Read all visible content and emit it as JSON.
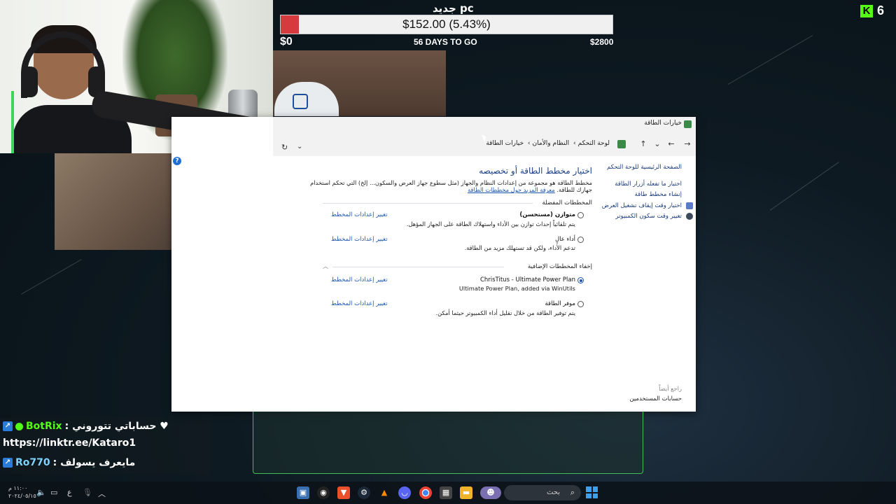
{
  "goal": {
    "title": "جديد pc",
    "amount_text": "$152.00 (5.43%)",
    "progress_fraction": 0.0543,
    "min_label": "$0",
    "days_label": "56 DAYS TO GO",
    "max_label": "$2800",
    "fill_color": "#d63a3f"
  },
  "kick": {
    "logo_letter": "K",
    "viewer_count": "6",
    "brand_color": "#53fc18"
  },
  "window": {
    "title": "خيارات الطاقة",
    "address": {
      "crumbs": [
        "لوحة التحكم",
        "النظام والأمان",
        "خيارات الطاقة"
      ]
    },
    "sidebar": {
      "home": "الصفحة الرئيسية للوحة التحكم",
      "items": [
        "اختيار ما تفعله أزرار الطاقة",
        "إنشاء مخطط طاقة",
        "اختيار وقت إيقاف تشغيل العرض",
        "تغيير وقت سكون الكمبيوتر"
      ],
      "see_also": "راجع أيضاً",
      "user_accounts": "حسابات المستخدمين"
    },
    "main": {
      "title": "اختيار مخطط الطاقة أو تخصيصه",
      "description_line1": "مخطط الطاقة هو مجموعة من إعدادات النظام والجهاز (مثل سطوع جهاز العرض والسكون... إلخ) التي تحكم استخدام",
      "description_line2": "جهازك للطاقة.",
      "learn_more_link": "معرفة المزيد حول مخططات الطاقة",
      "preferred_header": "المخططات المفضلة",
      "hide_header": "إخفاء المخططات الإضافية",
      "change_label": "تغيير إعدادات المخطط",
      "plans": [
        {
          "name": "متوازن (مستحسن)",
          "desc": "يتم تلقائياً إحداث توازن بين الأداء واستهلاك الطاقة على الجهاز المؤهل.",
          "selected": false,
          "bold": true
        },
        {
          "name": "أداء عالٍ",
          "desc": "تدعم الأداء، ولكن قد تستهلك مزيد من الطاقة.",
          "selected": false,
          "bold": false
        },
        {
          "name": "ChrisTitus - Ultimate Power Plan",
          "desc": "Ultimate Power Plan, added via WinUtils",
          "selected": true,
          "bold": false
        },
        {
          "name": "موفر الطاقة",
          "desc": "يتم توفير الطاقة من خلال تقليل أداء الكمبيوتر حيثما أمكن.",
          "selected": false,
          "bold": false
        }
      ]
    }
  },
  "chat": {
    "lines": [
      {
        "user": "BotRix",
        "message": ": حساباتي تتوروني ♥"
      },
      {
        "user": "",
        "message": "https://linktr.ee/Kataro1"
      },
      {
        "user": "Ro770",
        "message": ": مايعرف يسولف"
      }
    ]
  },
  "taskbar": {
    "search_placeholder": "بحث",
    "clock_time": "١١:٠٠ م",
    "clock_date": "٢٠٢٤/٠٥/١٥",
    "language": "ع",
    "icons": [
      "start-icon",
      "search-icon",
      "people-app-icon",
      "file-explorer-icon",
      "store-icon",
      "chrome-icon",
      "discord-icon",
      "vlc-icon",
      "obs-icon",
      "brave-icon",
      "steam-icon",
      "photos-icon"
    ]
  }
}
